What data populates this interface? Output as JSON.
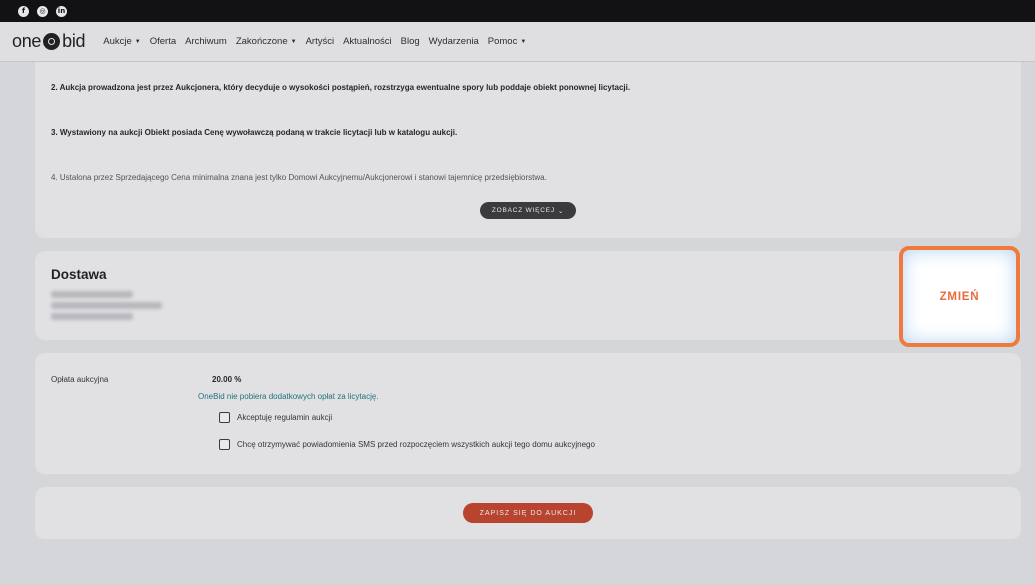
{
  "social": {
    "icons": [
      "facebook-icon",
      "instagram-icon",
      "linkedin-icon"
    ],
    "glyphs": [
      "f",
      "◎",
      "in"
    ]
  },
  "nav": {
    "logo_left": "one",
    "logo_right": "bid",
    "items": [
      {
        "label": "Aukcje",
        "dropdown": true
      },
      {
        "label": "Oferta",
        "dropdown": false
      },
      {
        "label": "Archiwum",
        "dropdown": false
      },
      {
        "label": "Zakończone",
        "dropdown": true
      },
      {
        "label": "Artyści",
        "dropdown": false
      },
      {
        "label": "Aktualności",
        "dropdown": false
      },
      {
        "label": "Blog",
        "dropdown": false
      },
      {
        "label": "Wydarzenia",
        "dropdown": false
      },
      {
        "label": "Pomoc",
        "dropdown": true
      }
    ]
  },
  "terms": {
    "items": [
      "2. Aukcja prowadzona jest przez Aukcjonera, który decyduje o wysokości postąpień, rozstrzyga ewentualne spory lub poddaje obiekt ponownej licytacji.",
      "3. Wystawiony na aukcji Obiekt posiada Cenę wywoławczą podaną w trakcie licytacji lub w katalogu aukcji.",
      "4. Ustalona przez Sprzedającego Cena minimalna znana jest tylko Domowi Aukcyjnemu/Aukcjonerowi i stanowi tajemnicę przedsiębiorstwa."
    ],
    "show_more_label": "ZOBACZ WIĘCEJ",
    "show_more_icon": "chevron-down-icon"
  },
  "delivery": {
    "title": "Dostawa",
    "change_label": "ZMIEŃ"
  },
  "fees": {
    "label": "Opłata aukcyjna",
    "value": "20.00 %",
    "note": "OneBid nie pobiera dodatkowych opłat za licytację.",
    "checkboxes": [
      "Akceptuję regulamin aukcji",
      "Chcę otrzymywać powiadomienia SMS przed rozpoczęciem wszystkich aukcji tego domu aukcyjnego"
    ]
  },
  "submit": {
    "label": "ZAPISZ SIĘ DO AUKCJI"
  },
  "colors": {
    "accent": "#ea6a3c",
    "highlight_border": "#f07a3e",
    "submit_bg": "#c8432a",
    "note_text": "#1b7a7f"
  }
}
